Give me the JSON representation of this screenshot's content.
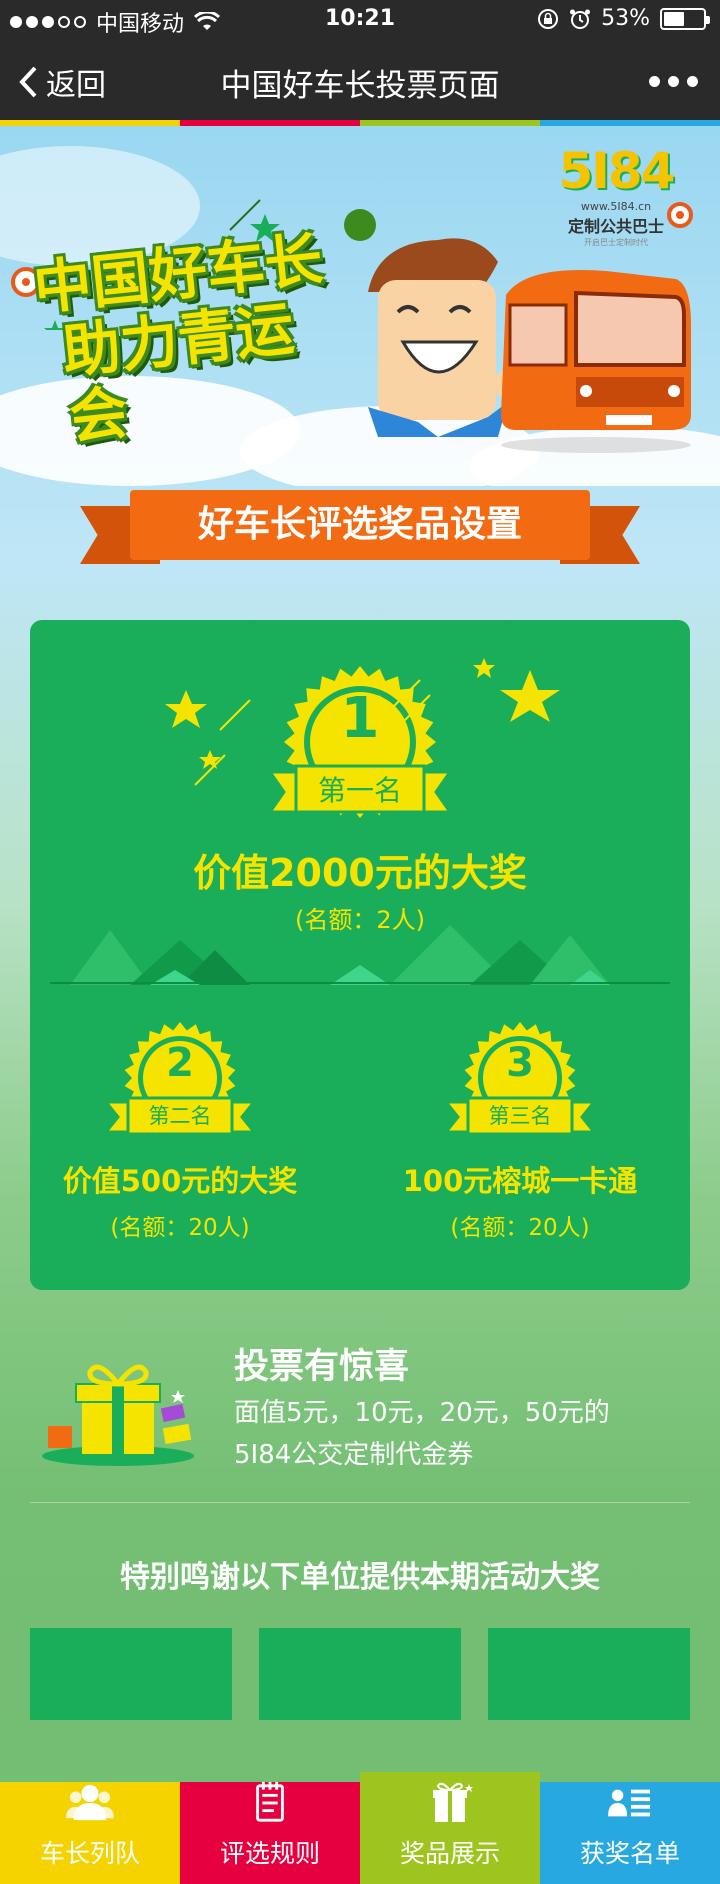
{
  "status_bar": {
    "carrier": "中国移动",
    "time": "10:21",
    "battery": "53%",
    "battery_level": 0.53
  },
  "nav": {
    "back_label": "返回",
    "title": "中国好车长投票页面"
  },
  "colors": {
    "yellow": "#f5d300",
    "red": "#e7003f",
    "lime": "#9ec51e",
    "blue": "#28a8e0",
    "orange": "#f26a11",
    "card_green": "#1aad5a",
    "text_yellow": "#f5e400"
  },
  "hero": {
    "title_line1": "中国好车长",
    "title_line2": "助力青运会",
    "logo_text": "5I84",
    "logo_url": "www.5I84.cn",
    "logo_slogan": "定制公共巴士",
    "logo_tagline": "开启巴士定制时代"
  },
  "banner": {
    "title": "好车长评选奖品设置"
  },
  "prizes": {
    "first": {
      "rank": "1",
      "badge": "第一名",
      "label": "价值2000元的大奖",
      "quota": "(名额：2人)"
    },
    "second": {
      "rank": "2",
      "badge": "第二名",
      "label": "价值500元的大奖",
      "quota": "(名额：20人)"
    },
    "third": {
      "rank": "3",
      "badge": "第三名",
      "label": "100元榕城一卡通",
      "quota": "(名额：20人)"
    }
  },
  "surprise": {
    "title": "投票有惊喜",
    "line1": "面值5元，10元，20元，50元的",
    "line2": "5I84公交定制代金券"
  },
  "thanks": {
    "title": "特别鸣谢以下单位提供本期活动大奖"
  },
  "tabs": [
    {
      "label": "车长列队",
      "icon": "users-icon"
    },
    {
      "label": "评选规则",
      "icon": "notepad-icon"
    },
    {
      "label": "奖品展示",
      "icon": "gift-icon"
    },
    {
      "label": "获奖名单",
      "icon": "contact-list-icon"
    }
  ]
}
